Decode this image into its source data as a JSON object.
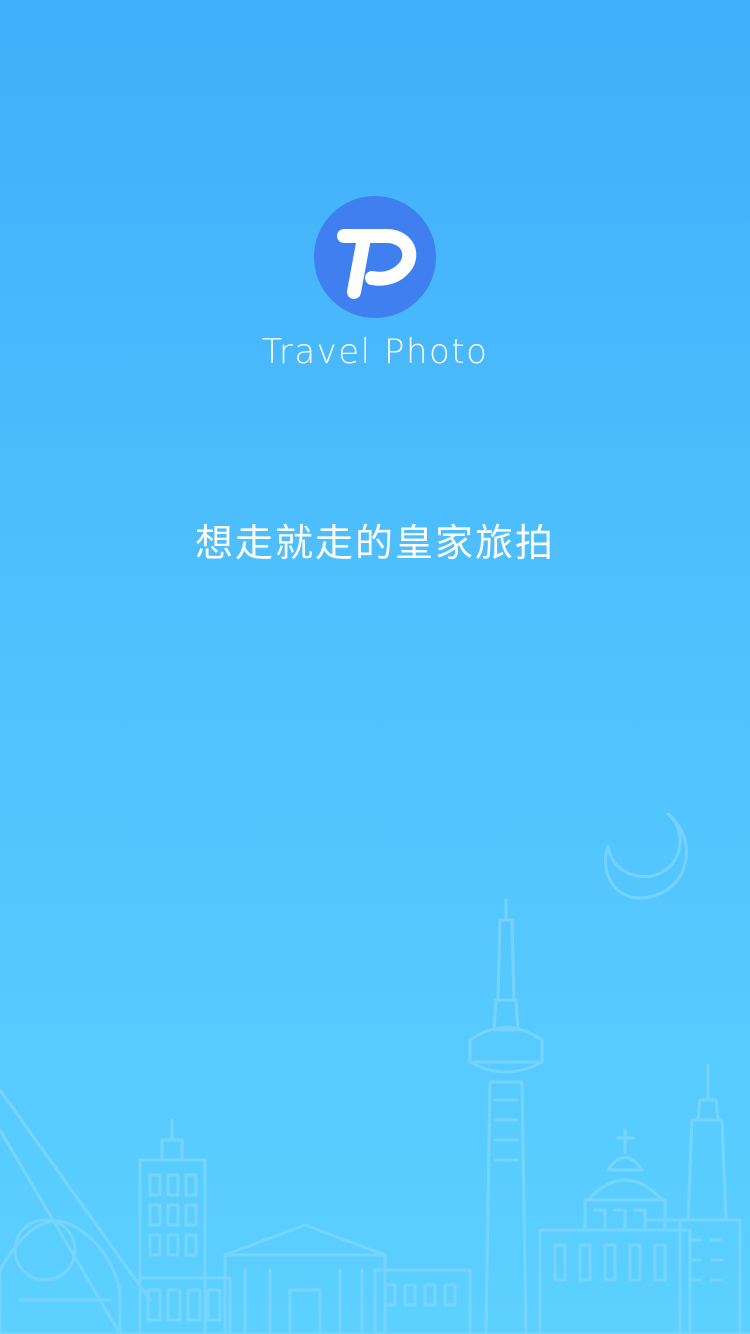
{
  "splash": {
    "app_name": "Travel Photo",
    "tagline": "想走就走的皇家旅拍",
    "logo": {
      "icon": "tp-logo-icon",
      "background_color": "#3f7ff0",
      "mark_color": "#ffffff"
    },
    "background": {
      "gradient_top": "#40aefb",
      "gradient_bottom": "#5cd0fe"
    },
    "illustration": {
      "icon": "city-skyline-icon",
      "moon_icon": "crescent-moon-icon",
      "line_color": "#7fd8ff"
    }
  }
}
